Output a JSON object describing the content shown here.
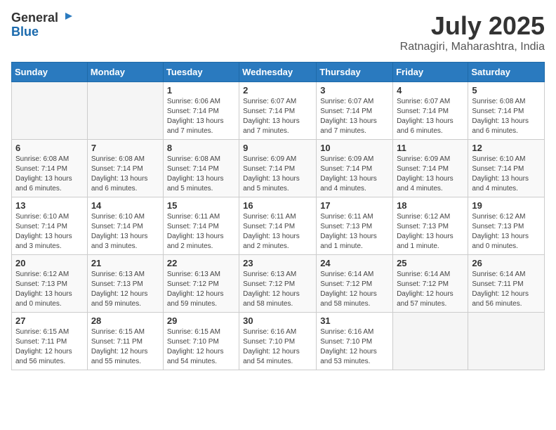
{
  "header": {
    "logo_general": "General",
    "logo_blue": "Blue",
    "month": "July 2025",
    "location": "Ratnagiri, Maharashtra, India"
  },
  "weekdays": [
    "Sunday",
    "Monday",
    "Tuesday",
    "Wednesday",
    "Thursday",
    "Friday",
    "Saturday"
  ],
  "weeks": [
    [
      {
        "day": "",
        "detail": ""
      },
      {
        "day": "",
        "detail": ""
      },
      {
        "day": "1",
        "detail": "Sunrise: 6:06 AM\nSunset: 7:14 PM\nDaylight: 13 hours and 7 minutes."
      },
      {
        "day": "2",
        "detail": "Sunrise: 6:07 AM\nSunset: 7:14 PM\nDaylight: 13 hours and 7 minutes."
      },
      {
        "day": "3",
        "detail": "Sunrise: 6:07 AM\nSunset: 7:14 PM\nDaylight: 13 hours and 7 minutes."
      },
      {
        "day": "4",
        "detail": "Sunrise: 6:07 AM\nSunset: 7:14 PM\nDaylight: 13 hours and 6 minutes."
      },
      {
        "day": "5",
        "detail": "Sunrise: 6:08 AM\nSunset: 7:14 PM\nDaylight: 13 hours and 6 minutes."
      }
    ],
    [
      {
        "day": "6",
        "detail": "Sunrise: 6:08 AM\nSunset: 7:14 PM\nDaylight: 13 hours and 6 minutes."
      },
      {
        "day": "7",
        "detail": "Sunrise: 6:08 AM\nSunset: 7:14 PM\nDaylight: 13 hours and 6 minutes."
      },
      {
        "day": "8",
        "detail": "Sunrise: 6:08 AM\nSunset: 7:14 PM\nDaylight: 13 hours and 5 minutes."
      },
      {
        "day": "9",
        "detail": "Sunrise: 6:09 AM\nSunset: 7:14 PM\nDaylight: 13 hours and 5 minutes."
      },
      {
        "day": "10",
        "detail": "Sunrise: 6:09 AM\nSunset: 7:14 PM\nDaylight: 13 hours and 4 minutes."
      },
      {
        "day": "11",
        "detail": "Sunrise: 6:09 AM\nSunset: 7:14 PM\nDaylight: 13 hours and 4 minutes."
      },
      {
        "day": "12",
        "detail": "Sunrise: 6:10 AM\nSunset: 7:14 PM\nDaylight: 13 hours and 4 minutes."
      }
    ],
    [
      {
        "day": "13",
        "detail": "Sunrise: 6:10 AM\nSunset: 7:14 PM\nDaylight: 13 hours and 3 minutes."
      },
      {
        "day": "14",
        "detail": "Sunrise: 6:10 AM\nSunset: 7:14 PM\nDaylight: 13 hours and 3 minutes."
      },
      {
        "day": "15",
        "detail": "Sunrise: 6:11 AM\nSunset: 7:14 PM\nDaylight: 13 hours and 2 minutes."
      },
      {
        "day": "16",
        "detail": "Sunrise: 6:11 AM\nSunset: 7:14 PM\nDaylight: 13 hours and 2 minutes."
      },
      {
        "day": "17",
        "detail": "Sunrise: 6:11 AM\nSunset: 7:13 PM\nDaylight: 13 hours and 1 minute."
      },
      {
        "day": "18",
        "detail": "Sunrise: 6:12 AM\nSunset: 7:13 PM\nDaylight: 13 hours and 1 minute."
      },
      {
        "day": "19",
        "detail": "Sunrise: 6:12 AM\nSunset: 7:13 PM\nDaylight: 13 hours and 0 minutes."
      }
    ],
    [
      {
        "day": "20",
        "detail": "Sunrise: 6:12 AM\nSunset: 7:13 PM\nDaylight: 13 hours and 0 minutes."
      },
      {
        "day": "21",
        "detail": "Sunrise: 6:13 AM\nSunset: 7:13 PM\nDaylight: 12 hours and 59 minutes."
      },
      {
        "day": "22",
        "detail": "Sunrise: 6:13 AM\nSunset: 7:12 PM\nDaylight: 12 hours and 59 minutes."
      },
      {
        "day": "23",
        "detail": "Sunrise: 6:13 AM\nSunset: 7:12 PM\nDaylight: 12 hours and 58 minutes."
      },
      {
        "day": "24",
        "detail": "Sunrise: 6:14 AM\nSunset: 7:12 PM\nDaylight: 12 hours and 58 minutes."
      },
      {
        "day": "25",
        "detail": "Sunrise: 6:14 AM\nSunset: 7:12 PM\nDaylight: 12 hours and 57 minutes."
      },
      {
        "day": "26",
        "detail": "Sunrise: 6:14 AM\nSunset: 7:11 PM\nDaylight: 12 hours and 56 minutes."
      }
    ],
    [
      {
        "day": "27",
        "detail": "Sunrise: 6:15 AM\nSunset: 7:11 PM\nDaylight: 12 hours and 56 minutes."
      },
      {
        "day": "28",
        "detail": "Sunrise: 6:15 AM\nSunset: 7:11 PM\nDaylight: 12 hours and 55 minutes."
      },
      {
        "day": "29",
        "detail": "Sunrise: 6:15 AM\nSunset: 7:10 PM\nDaylight: 12 hours and 54 minutes."
      },
      {
        "day": "30",
        "detail": "Sunrise: 6:16 AM\nSunset: 7:10 PM\nDaylight: 12 hours and 54 minutes."
      },
      {
        "day": "31",
        "detail": "Sunrise: 6:16 AM\nSunset: 7:10 PM\nDaylight: 12 hours and 53 minutes."
      },
      {
        "day": "",
        "detail": ""
      },
      {
        "day": "",
        "detail": ""
      }
    ]
  ]
}
